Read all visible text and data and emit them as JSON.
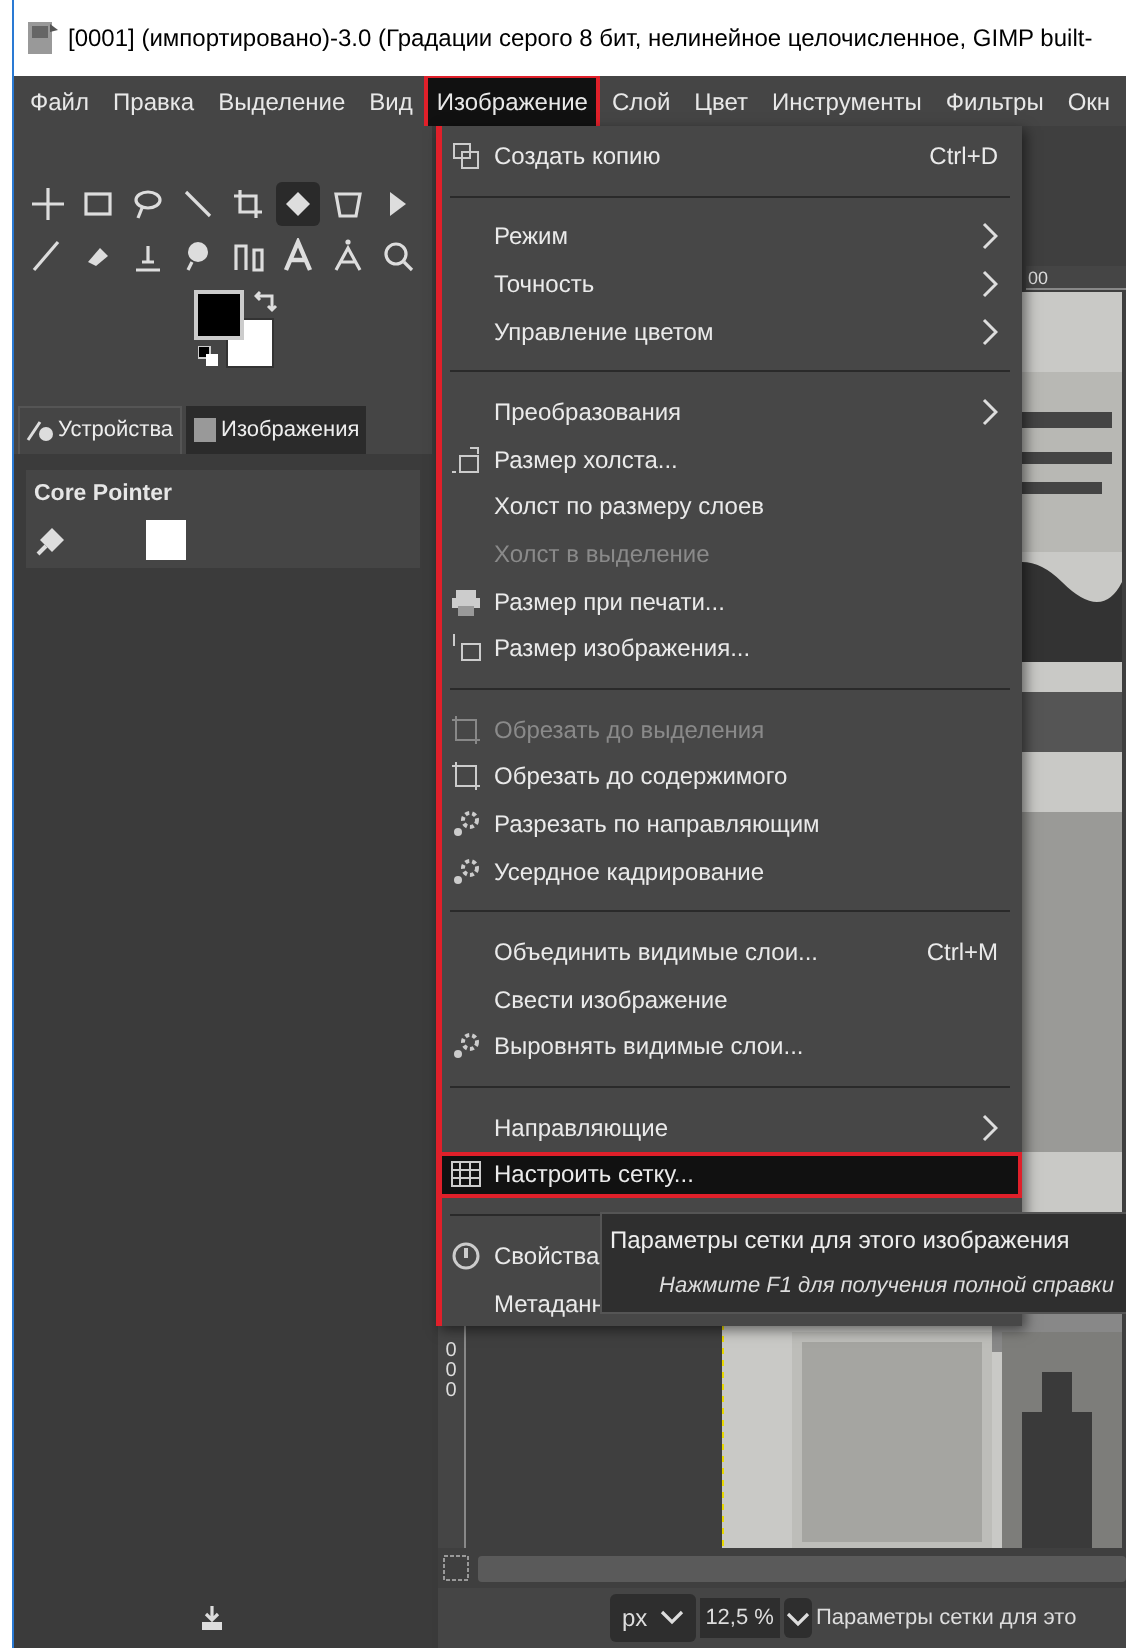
{
  "window": {
    "title": "[0001] (импортировано)-3.0 (Градации серого 8 бит, нелинейное целочисленное, GIMP built-"
  },
  "menubar": [
    {
      "label": "Файл",
      "selected": false
    },
    {
      "label": "Правка",
      "selected": false
    },
    {
      "label": "Выделение",
      "selected": false
    },
    {
      "label": "Вид",
      "selected": false
    },
    {
      "label": "Изображение",
      "selected": true
    },
    {
      "label": "Слой",
      "selected": false
    },
    {
      "label": "Цвет",
      "selected": false
    },
    {
      "label": "Инструменты",
      "selected": false
    },
    {
      "label": "Фильтры",
      "selected": false
    },
    {
      "label": "Окн",
      "selected": false
    }
  ],
  "toolbox": {
    "tabs": [
      {
        "label": "Устройства",
        "selected": true
      },
      {
        "label": "Изображения",
        "selected": false
      }
    ],
    "device": "Core Pointer"
  },
  "canvas": {
    "top_ruler": [
      "00"
    ],
    "left_ruler": [
      "0",
      "0",
      "0"
    ]
  },
  "menu": [
    {
      "kind": "item",
      "label": "Создать копию",
      "shortcut": "Ctrl+D",
      "submenu": false,
      "disabled": false,
      "selected": false
    },
    {
      "kind": "separator"
    },
    {
      "kind": "item",
      "label": "Режим",
      "submenu": true,
      "disabled": false,
      "selected": false
    },
    {
      "kind": "item",
      "label": "Точность",
      "submenu": true,
      "disabled": false,
      "selected": false
    },
    {
      "kind": "item",
      "label": "Управление цветом",
      "submenu": true,
      "disabled": false,
      "selected": false
    },
    {
      "kind": "separator"
    },
    {
      "kind": "item",
      "label": "Преобразования",
      "submenu": true,
      "disabled": false,
      "selected": false
    },
    {
      "kind": "item",
      "label": "Размер холста...",
      "submenu": false,
      "disabled": false,
      "selected": false
    },
    {
      "kind": "item",
      "label": "Холст по размеру слоев",
      "submenu": false,
      "disabled": false,
      "selected": false
    },
    {
      "kind": "item",
      "label": "Холст в выделение",
      "submenu": false,
      "disabled": true,
      "selected": false
    },
    {
      "kind": "item",
      "label": "Размер при печати...",
      "submenu": false,
      "disabled": false,
      "selected": false
    },
    {
      "kind": "item",
      "label": "Размер изображения...",
      "submenu": false,
      "disabled": false,
      "selected": false
    },
    {
      "kind": "separator"
    },
    {
      "kind": "item",
      "label": "Обрезать до выделения",
      "submenu": false,
      "disabled": true,
      "selected": false
    },
    {
      "kind": "item",
      "label": "Обрезать до содержимого",
      "submenu": false,
      "disabled": false,
      "selected": false
    },
    {
      "kind": "item",
      "label": "Разрезать по направляющим",
      "submenu": false,
      "disabled": false,
      "selected": false
    },
    {
      "kind": "item",
      "label": "Усердное кадрирование",
      "submenu": false,
      "disabled": false,
      "selected": false
    },
    {
      "kind": "separator"
    },
    {
      "kind": "item",
      "label": "Объединить видимые слои...",
      "shortcut": "Ctrl+M",
      "submenu": false,
      "disabled": false,
      "selected": false
    },
    {
      "kind": "item",
      "label": "Свести изображение",
      "submenu": false,
      "disabled": false,
      "selected": false
    },
    {
      "kind": "item",
      "label": "Выровнять видимые слои...",
      "submenu": false,
      "disabled": false,
      "selected": false
    },
    {
      "kind": "separator"
    },
    {
      "kind": "item",
      "label": "Направляющие",
      "submenu": true,
      "disabled": false,
      "selected": false
    },
    {
      "kind": "item",
      "label": "Настроить сетку...",
      "submenu": false,
      "disabled": false,
      "selected": true
    },
    {
      "kind": "separator"
    },
    {
      "kind": "item",
      "label": "Свойства",
      "submenu": false,
      "disabled": false,
      "selected": false
    },
    {
      "kind": "item",
      "label": "Метаданн",
      "submenu": false,
      "disabled": false,
      "selected": false
    }
  ],
  "tooltip": {
    "title": "Параметры сетки для этого изображения",
    "hint": "Нажмите F1 для получения полной справки"
  },
  "status_bar": {
    "unit": "px",
    "zoom": "12,5 %",
    "message": "Параметры сетки для это"
  }
}
